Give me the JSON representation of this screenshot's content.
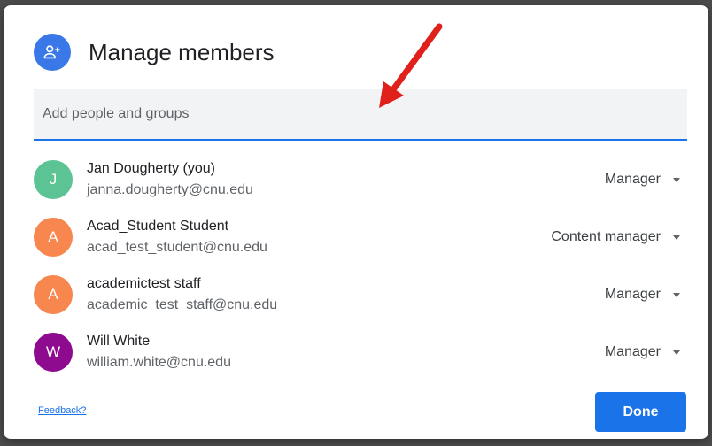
{
  "dialog": {
    "title": "Manage members",
    "header_icon": "person-add-icon"
  },
  "search": {
    "placeholder": "Add people and groups"
  },
  "members": [
    {
      "initial": "J",
      "name": "Jan Dougherty (you)",
      "email": "janna.dougherty@cnu.edu",
      "role": "Manager",
      "avatar_color": "#5cc494"
    },
    {
      "initial": "A",
      "name": "Acad_Student Student",
      "email": "acad_test_student@cnu.edu",
      "role": "Content manager",
      "avatar_color": "#f7864f"
    },
    {
      "initial": "A",
      "name": "academictest staff",
      "email": "academic_test_staff@cnu.edu",
      "role": "Manager",
      "avatar_color": "#f7864f"
    },
    {
      "initial": "W",
      "name": "Will White",
      "email": "william.white@cnu.edu",
      "role": "Manager",
      "avatar_color": "#8e0a8e"
    }
  ],
  "footer": {
    "feedback_label": "Feedback?",
    "done_label": "Done"
  },
  "colors": {
    "accent": "#1a73e8",
    "header_icon_bg": "#3b78e7",
    "annotation_arrow": "#e0201b"
  }
}
